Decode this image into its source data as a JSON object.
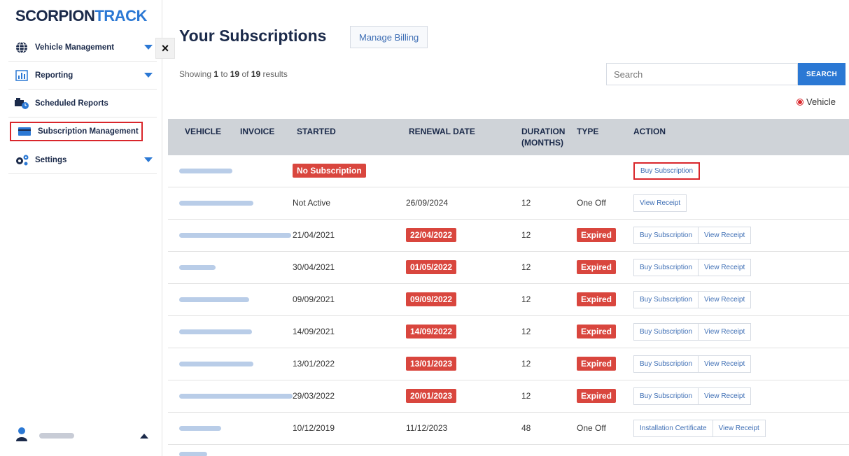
{
  "app": {
    "logo_main": "SCORPION",
    "logo_accent": "TRACK"
  },
  "sidebar": {
    "items": [
      {
        "label": "Vehicle Management",
        "icon": "globe-icon",
        "expandable": true
      },
      {
        "label": "Reporting",
        "icon": "bar-chart-icon",
        "expandable": true
      },
      {
        "label": "Scheduled Reports",
        "icon": "truck-clock-icon",
        "expandable": false
      },
      {
        "label": "Subscription Management",
        "icon": "card-icon",
        "expandable": false,
        "highlighted": true
      },
      {
        "label": "Settings",
        "icon": "gears-icon",
        "expandable": true
      }
    ],
    "user": {
      "icon": "user-icon"
    }
  },
  "close_label": "×",
  "page": {
    "title": "Your Subscriptions",
    "manage_billing": "Manage Billing",
    "results_prefix": "Showing ",
    "results_from": "1",
    "results_mid": " to ",
    "results_to": "19",
    "results_of": " of ",
    "results_total": "19",
    "results_suffix": " results",
    "search_placeholder": "Search",
    "search_button": "SEARCH",
    "radio_label": "Vehicle"
  },
  "table": {
    "headers": {
      "vehicle": "VEHICLE",
      "invoice": "INVOICE",
      "started": "STARTED",
      "renewal": "RENEWAL DATE",
      "duration_1": "DURATION",
      "duration_2": "(MONTHS)",
      "type": "TYPE",
      "action": "ACTION"
    },
    "rows": [
      {
        "started": "",
        "started_badge": "No Subscription",
        "renewal": "",
        "renewal_badge": "",
        "duration": "",
        "type": "",
        "type_badge": "",
        "actions": [
          "Buy Subscription"
        ]
      },
      {
        "started": "Not Active",
        "started_badge": "",
        "renewal": "26/09/2024",
        "renewal_badge": "",
        "duration": "12",
        "type": "One Off",
        "type_badge": "",
        "actions": [
          "View Receipt"
        ]
      },
      {
        "started": "21/04/2021",
        "started_badge": "",
        "renewal": "",
        "renewal_badge": "22/04/2022",
        "duration": "12",
        "type": "",
        "type_badge": "Expired",
        "actions": [
          "Buy Subscription",
          "View Receipt"
        ]
      },
      {
        "started": "30/04/2021",
        "started_badge": "",
        "renewal": "",
        "renewal_badge": "01/05/2022",
        "duration": "12",
        "type": "",
        "type_badge": "Expired",
        "actions": [
          "Buy Subscription",
          "View Receipt"
        ]
      },
      {
        "started": "09/09/2021",
        "started_badge": "",
        "renewal": "",
        "renewal_badge": "09/09/2022",
        "duration": "12",
        "type": "",
        "type_badge": "Expired",
        "actions": [
          "Buy Subscription",
          "View Receipt"
        ]
      },
      {
        "started": "14/09/2021",
        "started_badge": "",
        "renewal": "",
        "renewal_badge": "14/09/2022",
        "duration": "12",
        "type": "",
        "type_badge": "Expired",
        "actions": [
          "Buy Subscription",
          "View Receipt"
        ]
      },
      {
        "started": "13/01/2022",
        "started_badge": "",
        "renewal": "",
        "renewal_badge": "13/01/2023",
        "duration": "12",
        "type": "",
        "type_badge": "Expired",
        "actions": [
          "Buy Subscription",
          "View Receipt"
        ]
      },
      {
        "started": "29/03/2022",
        "started_badge": "",
        "renewal": "",
        "renewal_badge": "20/01/2023",
        "duration": "12",
        "type": "",
        "type_badge": "Expired",
        "actions": [
          "Buy Subscription",
          "View Receipt"
        ]
      },
      {
        "started": "10/12/2019",
        "started_badge": "",
        "renewal": "11/12/2023",
        "renewal_badge": "",
        "duration": "48",
        "type": "One Off",
        "type_badge": "",
        "actions": [
          "Installation Certificate",
          "View Receipt"
        ]
      }
    ]
  },
  "colors": {
    "brand_navy": "#1b2a4a",
    "accent_blue": "#2b78d4",
    "badge_red": "#d9463e",
    "highlight_red": "#d9262b",
    "header_grey": "#cfd3d8"
  }
}
